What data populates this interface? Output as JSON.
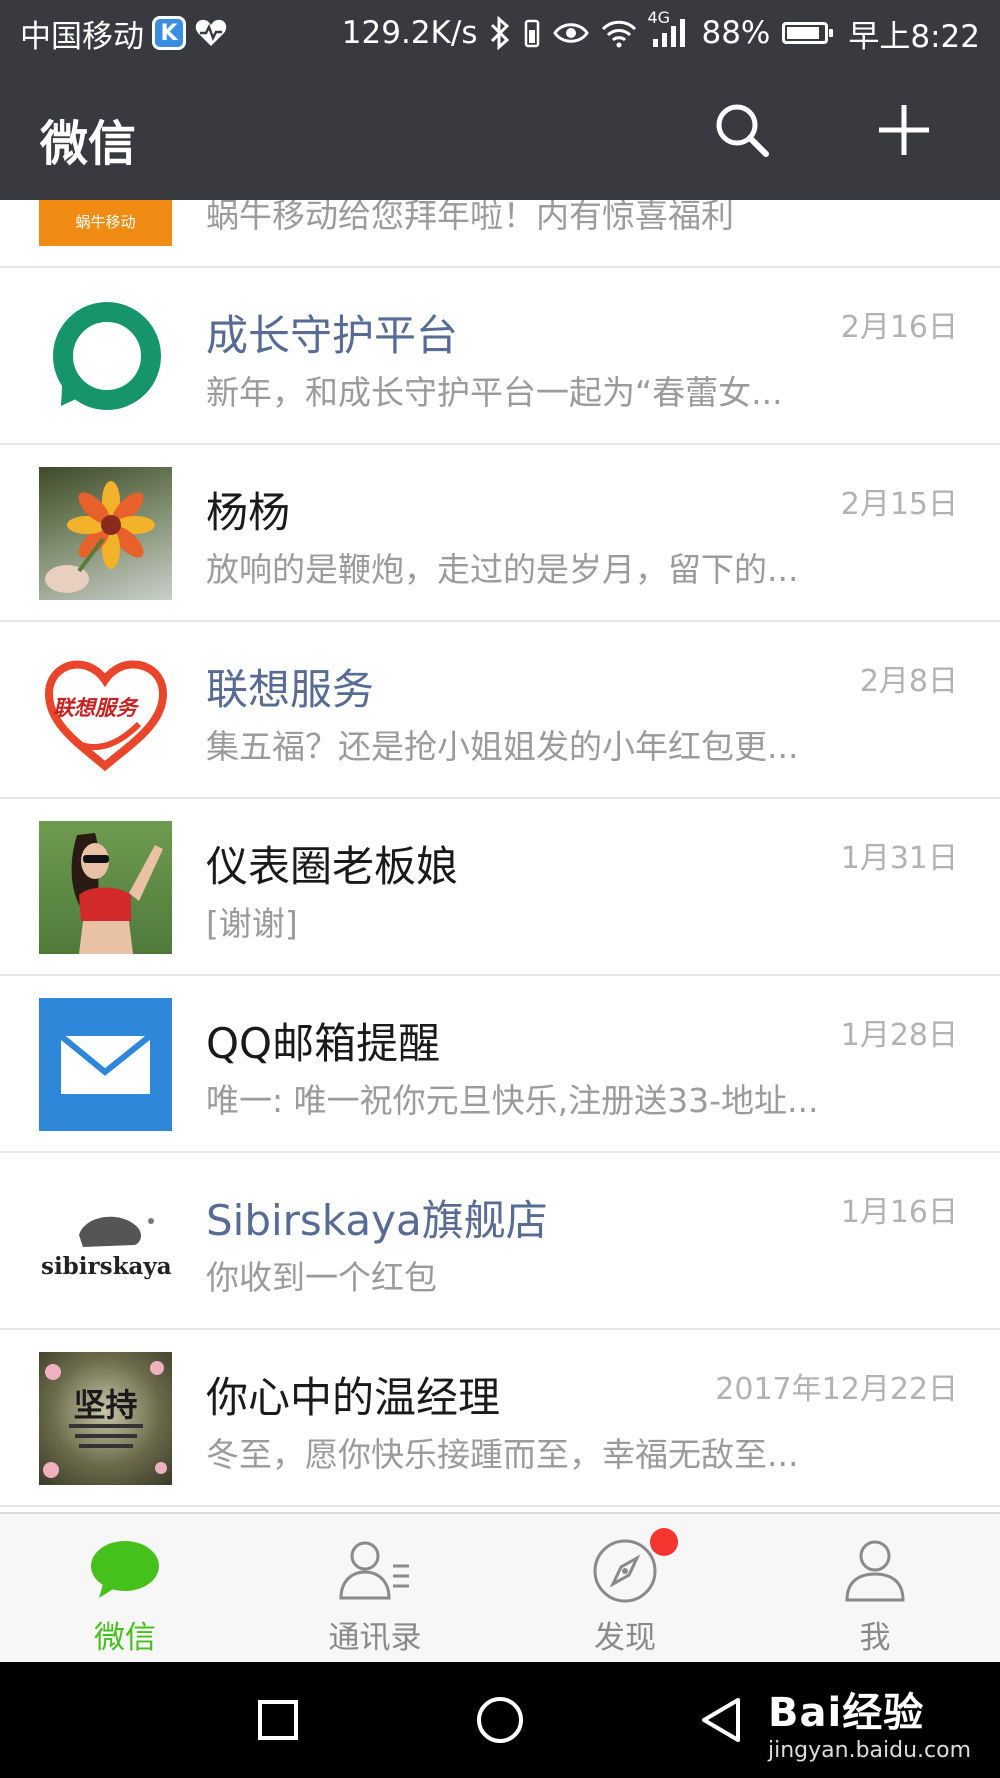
{
  "status_bar": {
    "carrier": "中国移动",
    "k_badge": "K",
    "net_speed": "129.2K/s",
    "signal_tag": "4G",
    "battery_text": "88%",
    "battery_level": 0.88,
    "time": "早上8:22"
  },
  "header": {
    "title": "微信",
    "search_icon": "search-icon",
    "add_icon": "plus-icon"
  },
  "chats": [
    {
      "name": "",
      "avatar_text": "蜗牛移动",
      "preview": "蜗牛移动给您拜年啦！内有惊喜福利",
      "time": "",
      "official": true
    },
    {
      "name": "成长守护平台",
      "preview": "新年，和成长守护平台一起为“春蕾女...",
      "time": "2月16日",
      "official": true
    },
    {
      "name": "杨杨",
      "preview": "放响的是鞭炮，走过的是岁月，留下的...",
      "time": "2月15日",
      "official": false
    },
    {
      "name": "联想服务",
      "avatar_text": "联想服务",
      "preview": "集五福？还是抢小姐姐发的小年红包更...",
      "time": "2月8日",
      "official": true
    },
    {
      "name": "仪表圈老板娘",
      "preview": "[谢谢]",
      "time": "1月31日",
      "official": false
    },
    {
      "name": "QQ邮箱提醒",
      "preview": "唯一: 唯一祝你元旦快乐,注册送33-地址...",
      "time": "1月28日",
      "official": false
    },
    {
      "name": "Sibirskaya旗舰店",
      "avatar_text": "sibirskaya",
      "preview": "你收到一个红包",
      "time": "1月16日",
      "official": true
    },
    {
      "name": "你心中的温经理",
      "avatar_text": "坚持",
      "preview": "冬至，愿你快乐接踵而至，幸福无敌至...",
      "time": "2017年12月22日",
      "official": false
    }
  ],
  "tabs": [
    {
      "label": "微信",
      "icon": "chat-bubble-icon",
      "active": true
    },
    {
      "label": "通讯录",
      "icon": "contacts-icon",
      "active": false
    },
    {
      "label": "发现",
      "icon": "compass-icon",
      "active": false
    },
    {
      "label": "我",
      "icon": "person-icon",
      "active": false
    }
  ],
  "watermark": {
    "brand": "Bai经验",
    "url": "jingyan.baidu.com"
  },
  "colors": {
    "header_bg": "#393a3f",
    "official_name": "#576b95",
    "active_tab": "#46c01b",
    "badge_dot": "#f43530"
  }
}
